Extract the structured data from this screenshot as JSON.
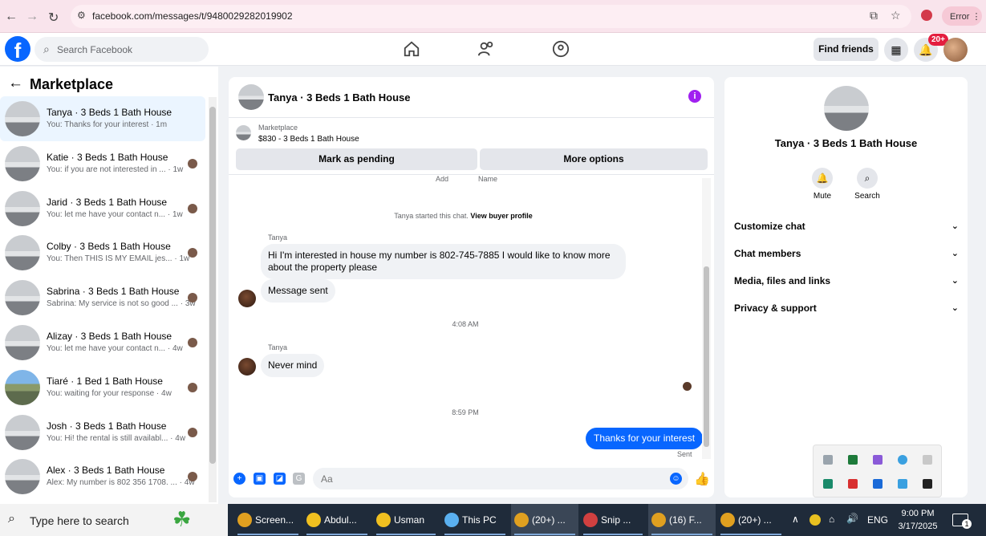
{
  "browser": {
    "url": "facebook.com/messages/t/9480029282019902",
    "error_label": "Error"
  },
  "header": {
    "search_placeholder": "Search Facebook",
    "find_friends": "Find friends",
    "notification_count": "20+"
  },
  "sidebar": {
    "title": "Marketplace",
    "conversations": [
      {
        "name": "Tanya · 3 Beds 1 Bath House",
        "preview": "You: Thanks for your interest · 1m",
        "active": true
      },
      {
        "name": "Katie · 3 Beds 1 Bath House",
        "preview": "You: if you are not interested in ... · 1w"
      },
      {
        "name": "Jarid · 3 Beds 1 Bath House",
        "preview": "You: let me have your contact n... · 1w"
      },
      {
        "name": "Colby · 3 Beds 1 Bath House",
        "preview": "You: Then THIS IS MY EMAIL jes... · 1w"
      },
      {
        "name": "Sabrina · 3 Beds 1 Bath House",
        "preview": "Sabrina: My service is not so good ... · 3w"
      },
      {
        "name": "Alizay · 3 Beds 1 Bath House",
        "preview": "You: let me have your contact n... · 4w"
      },
      {
        "name": "Tiaré · 1 Bed 1 Bath House",
        "preview": "You: waiting for your response · 4w"
      },
      {
        "name": "Josh · 3 Beds 1 Bath House",
        "preview": "You: Hi! the rental is still availabl... · 4w"
      },
      {
        "name": "Alex · 3 Beds 1 Bath House",
        "preview": "Alex: My number is 802 356 1708. ... · 4w"
      }
    ]
  },
  "chat": {
    "title": "Tanya · 3 Beds 1 Bath House",
    "marketplace_label": "Marketplace",
    "listing": "$830 - 3 Beds 1 Bath House",
    "mark_pending": "Mark as pending",
    "more_options": "More options",
    "cutoff_left": "Add",
    "cutoff_right": "Name",
    "started": "Tanya started this chat.",
    "view_profile": "View buyer profile",
    "sender1": "Tanya",
    "msg1": "Hi I'm interested in house my number is 802-745-7885 I would like to know more about the property please",
    "msg2": "Message sent",
    "time1": "4:08 AM",
    "sender2": "Tanya",
    "msg3": "Never mind",
    "time2": "8:59 PM",
    "out_msg": "Thanks for your interest",
    "sent_label": "Sent",
    "composer_placeholder": "Aa"
  },
  "right_panel": {
    "name": "Tanya · 3 Beds 1 Bath House",
    "mute": "Mute",
    "search": "Search",
    "rows": [
      "Customize chat",
      "Chat members",
      "Media, files and links",
      "Privacy & support"
    ]
  },
  "taskbar": {
    "search_placeholder": "Type here to search",
    "items": [
      "Screen...",
      "Abdul...",
      "Usman",
      "This PC",
      "(20+) ...",
      "Snip ...",
      "(16) F...",
      "(20+) ..."
    ],
    "language": "ENG",
    "time": "9:00 PM",
    "date": "3/17/2025",
    "notif_count": "1"
  }
}
